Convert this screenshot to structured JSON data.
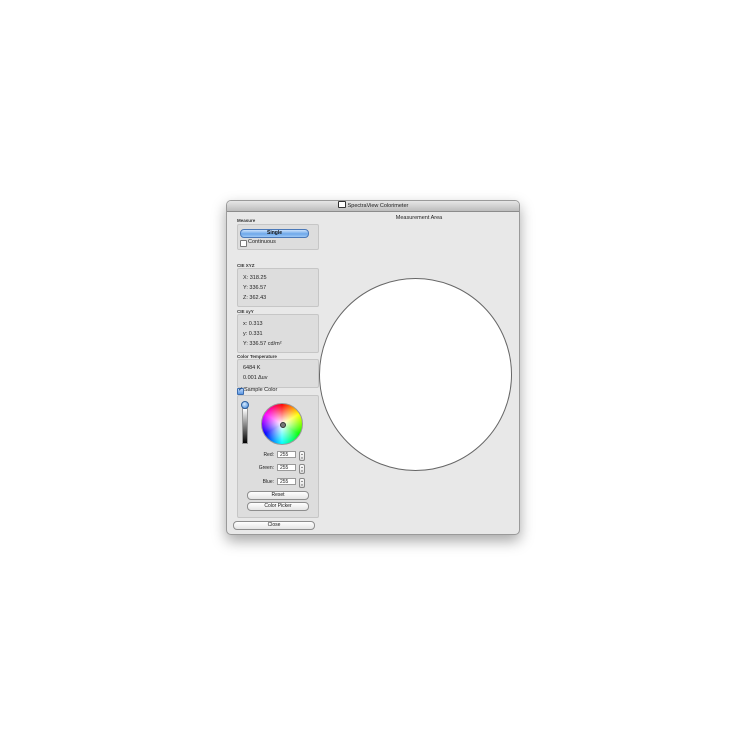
{
  "window": {
    "title": "SpectraView Colorimeter"
  },
  "measure": {
    "label": "Measure",
    "single_label": "Single",
    "continuous_label": "Continuous"
  },
  "cie_xyz": {
    "label": "CIE XYZ",
    "x": "X: 318.25",
    "y": "Y: 336.57",
    "z": "Z: 362.43"
  },
  "cie_xyy": {
    "label": "CIE xyY",
    "x": "x: 0.313",
    "y": "y: 0.331",
    "Y": "Y: 336.57 cd/m²"
  },
  "color_temperature": {
    "label": "Color Temperature",
    "kelvin": "6484 K",
    "duv": "0.001 Δuv"
  },
  "sample_color": {
    "label": "Sample Color",
    "checked": true,
    "red_label": "Red:",
    "red_value": "255",
    "green_label": "Green:",
    "green_value": "255",
    "blue_label": "Blue:",
    "blue_value": "255",
    "reset_label": "Reset",
    "color_picker_label": "Color Picker"
  },
  "close_label": "Close",
  "measurement_area": {
    "title": "Measurement Area"
  },
  "icons": [
    "app-icon",
    "color-wheel-icon",
    "brightness-slider-icon",
    "checkbox-icon",
    "stepper-icon"
  ],
  "colors": {
    "window_bg": "#e8e8e8",
    "accent": "#6ea8ea",
    "measurement_fill": "#ffffff"
  }
}
